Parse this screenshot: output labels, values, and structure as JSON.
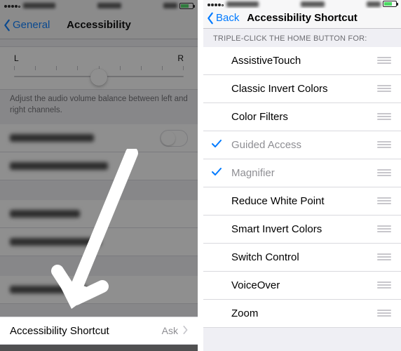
{
  "left": {
    "nav": {
      "back": "General",
      "title": "Accessibility"
    },
    "slider": {
      "left_label": "L",
      "right_label": "R"
    },
    "footer": "Adjust the audio volume balance between left and right channels.",
    "shortcut_row": {
      "label": "Accessibility Shortcut",
      "detail": "Ask"
    }
  },
  "right": {
    "nav": {
      "back": "Back",
      "title": "Accessibility Shortcut"
    },
    "section_header": "Triple-click the home button for:",
    "items": [
      {
        "label": "AssistiveTouch",
        "checked": false
      },
      {
        "label": "Classic Invert Colors",
        "checked": false
      },
      {
        "label": "Color Filters",
        "checked": false
      },
      {
        "label": "Guided Access",
        "checked": true
      },
      {
        "label": "Magnifier",
        "checked": true
      },
      {
        "label": "Reduce White Point",
        "checked": false
      },
      {
        "label": "Smart Invert Colors",
        "checked": false
      },
      {
        "label": "Switch Control",
        "checked": false
      },
      {
        "label": "VoiceOver",
        "checked": false
      },
      {
        "label": "Zoom",
        "checked": false
      }
    ]
  }
}
